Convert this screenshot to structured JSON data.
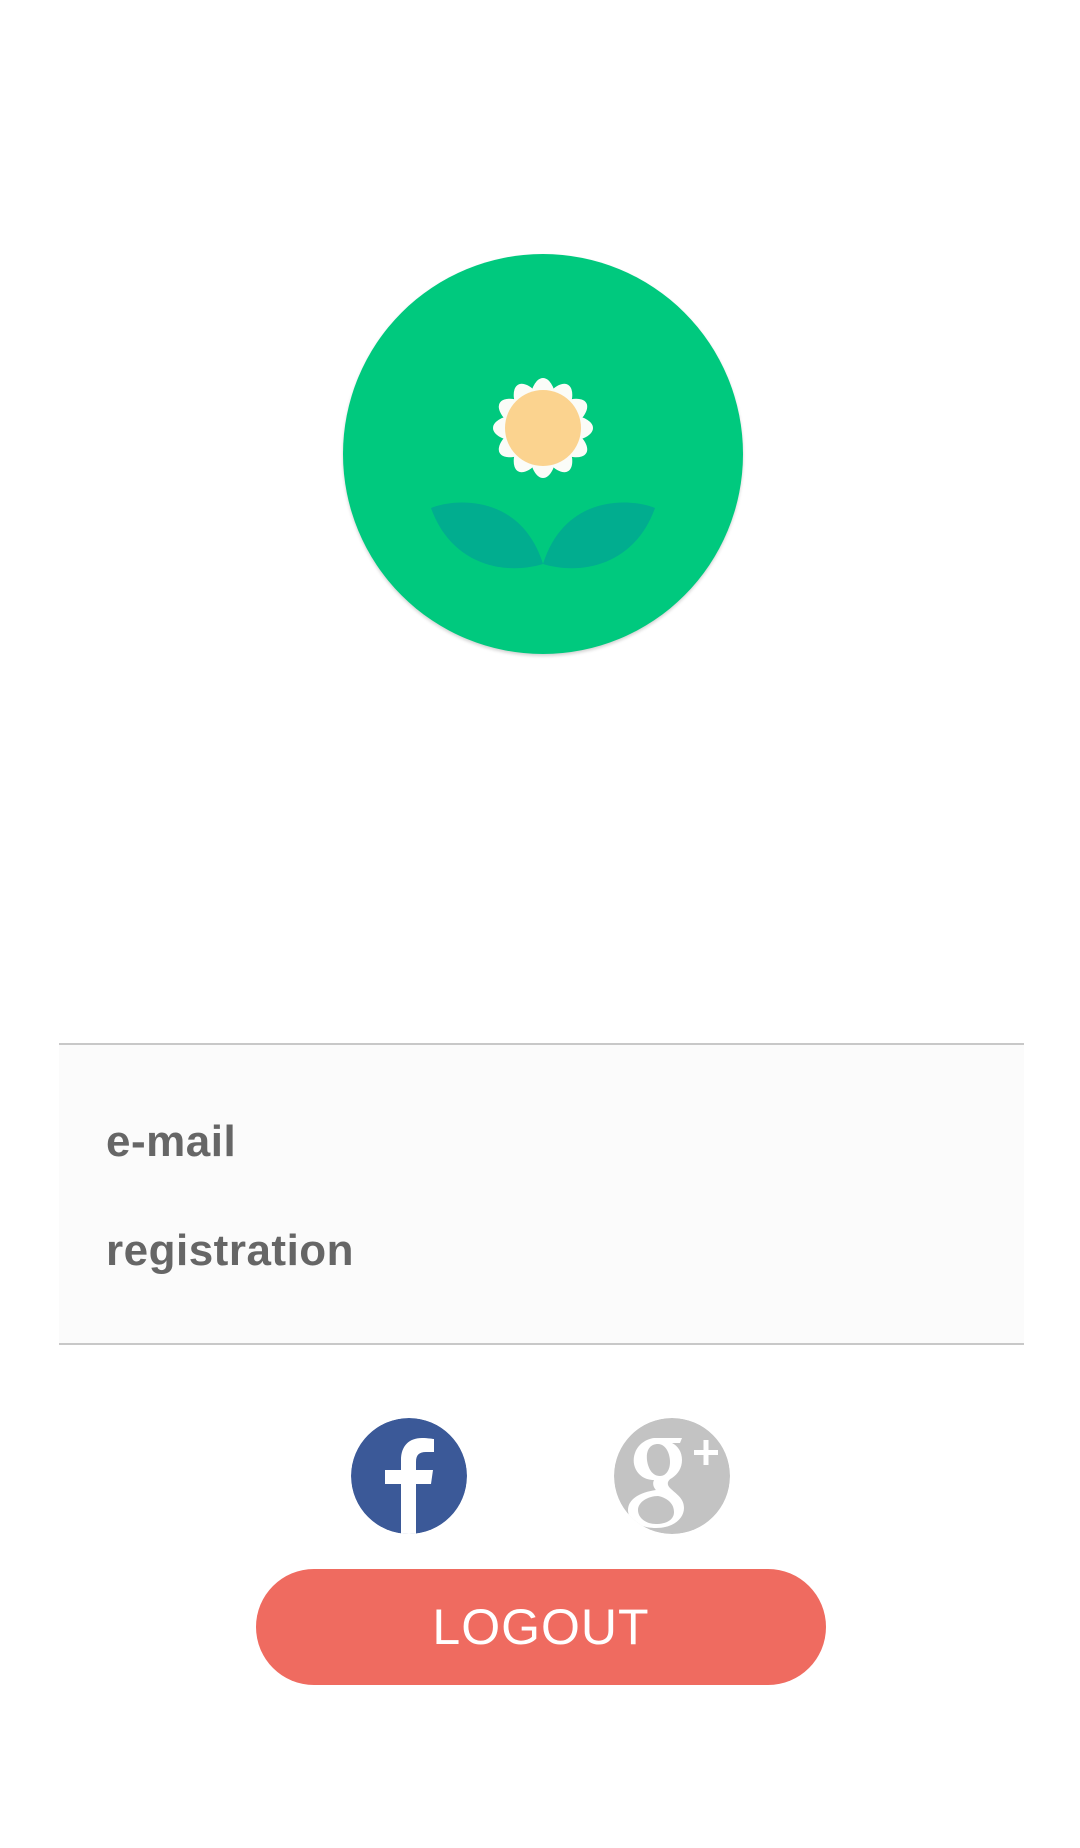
{
  "profile": {
    "logo_icon": "daisy-flower-icon",
    "email_label": "e-mail",
    "registration_label": "registration"
  },
  "social": {
    "facebook_icon": "facebook-icon",
    "facebook_color": "#3b5998",
    "googleplus_icon": "google-plus-icon",
    "googleplus_color": "#c3c3c3"
  },
  "actions": {
    "logout_label": "LOGOUT"
  },
  "colors": {
    "logo_background": "#00c97e",
    "leaf": "#01ad8f",
    "flower_center": "#fbd38f",
    "logout_background": "#ef6b60",
    "label_text": "#666666"
  }
}
